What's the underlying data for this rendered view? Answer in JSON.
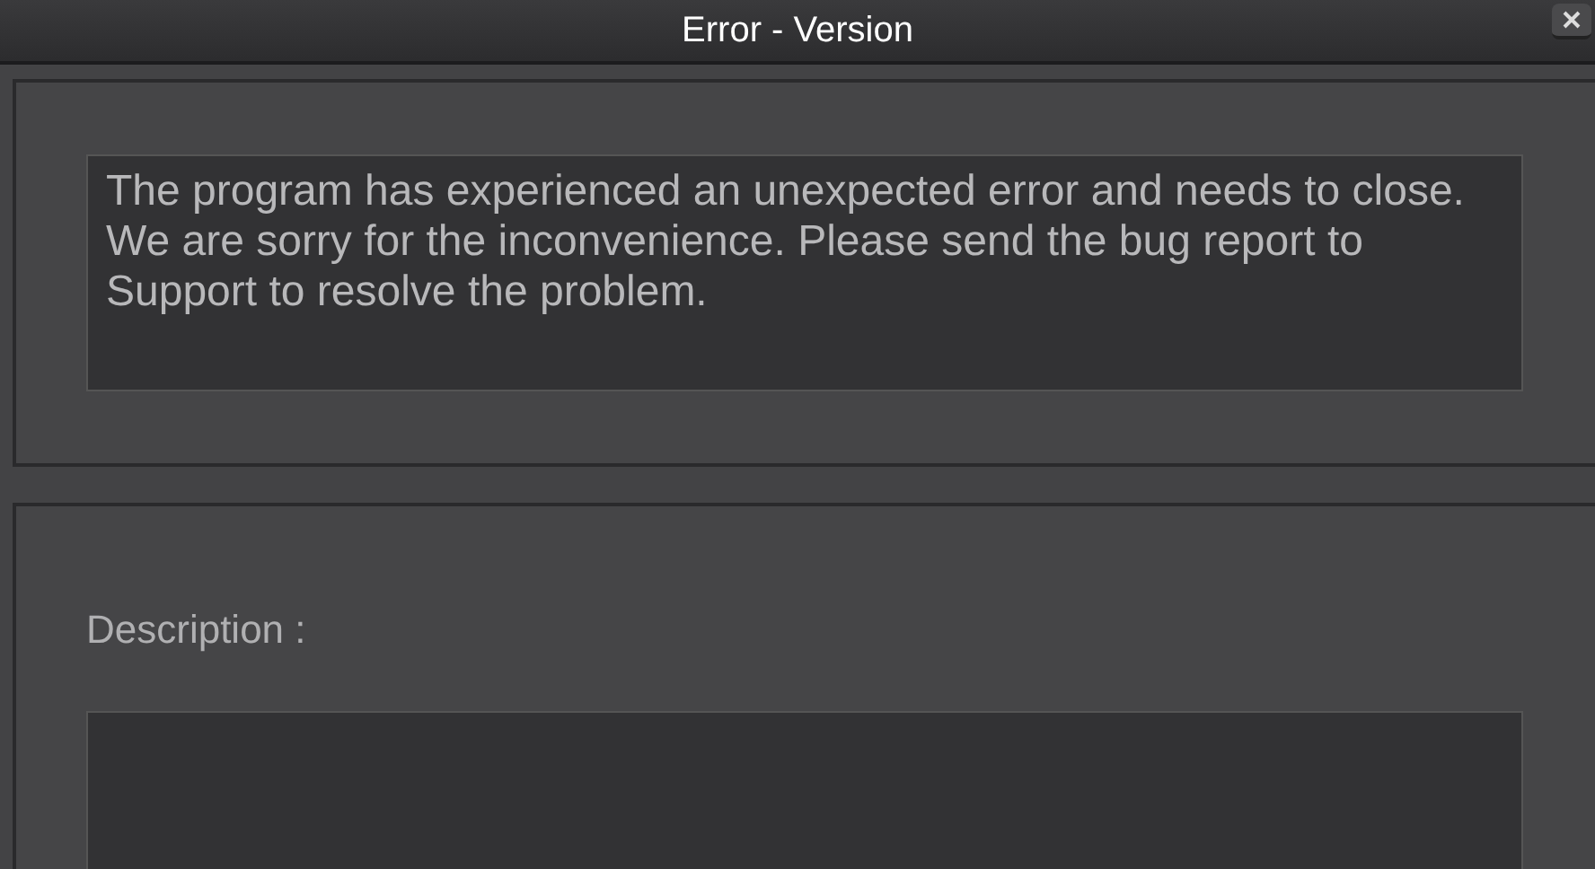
{
  "window": {
    "title": "Error - Version"
  },
  "message": "The program has experienced an unexpected error and needs to close. We are sorry for the inconvenience. Please send the bug report to Support to resolve the problem.",
  "description": {
    "label": "Description :"
  }
}
